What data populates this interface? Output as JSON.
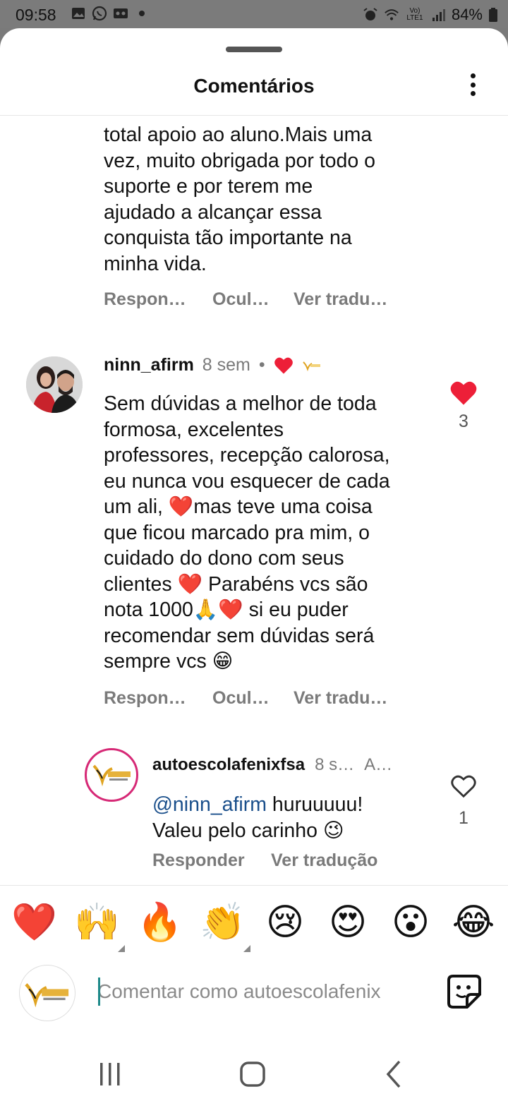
{
  "status_bar": {
    "time": "09:58",
    "battery": "84%",
    "network": "Vo) LTE1"
  },
  "sheet": {
    "title": "Comentários"
  },
  "comments": [
    {
      "text": "total apoio ao aluno.Mais uma\nvez, muito obrigada por todo o\nsuporte e por terem me\najudado a alcançar essa\nconquista tão importante na\nminha vida.",
      "actions": [
        "Respon…",
        "Ocul…",
        "Ver tradu…"
      ]
    },
    {
      "username": "ninn_afirm",
      "time": "8 sem",
      "dot": "•",
      "text": "Sem dúvidas a melhor de toda\nformosa, excelentes\nprofessores, recepção calorosa,\neu nunca vou esquecer de cada\num ali, ❤️mas teve uma coisa\nque ficou marcado pra mim, o\ncuidado do dono com seus\nclientes ❤️ Parabéns vcs são\nnota 1000🙏❤️ si eu puder\nrecomendar sem dúvidas será\nsempre vcs 😁",
      "actions": [
        "Respon…",
        "Ocul…",
        "Ver tradu…"
      ],
      "likes": "3",
      "liked": true
    },
    {
      "username": "autoescolafenixfsa",
      "time": "8 s…",
      "author_tag": "A…",
      "mention": "@ninn_afirm",
      "text_after_mention": " huruuuuu!\nValeu pelo carinho 😉",
      "actions": [
        "Responder",
        "Ver tradução"
      ],
      "likes": "1",
      "liked": false
    }
  ],
  "reaction_emojis": [
    "❤️",
    "🙌",
    "🔥",
    "👏",
    "😢",
    "😍",
    "😮",
    "😂"
  ],
  "composer": {
    "placeholder": "Comentar como autoescolafenix"
  },
  "colors": {
    "like_red": "#ed1f38",
    "mention_blue": "#1a4f8b",
    "muted": "#7a7a7a"
  }
}
